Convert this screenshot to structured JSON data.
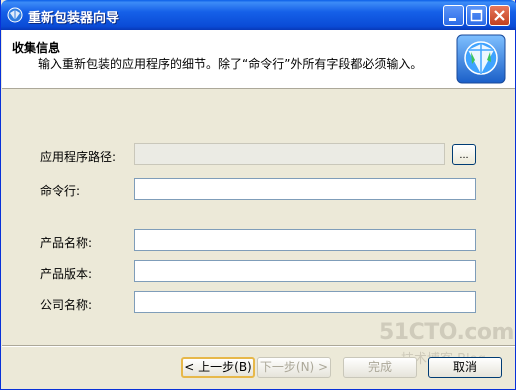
{
  "window": {
    "title": "重新包装器向导"
  },
  "header": {
    "title": "收集信息",
    "subtitle": "输入重新包装的应用程序的细节。除了“命令行”外所有字段都必须输入。"
  },
  "form": {
    "app_path_label": "应用程序路径:",
    "app_path_value": "",
    "browse_label": "...",
    "command_line_label": "命令行:",
    "command_line_value": "",
    "product_name_label": "产品名称:",
    "product_name_value": "",
    "product_version_label": "产品版本:",
    "product_version_value": "",
    "company_name_label": "公司名称:",
    "company_name_value": ""
  },
  "buttons": {
    "back": "< 上一步(B)",
    "next": "下一步(N) >",
    "finish": "完成",
    "cancel": "取消"
  },
  "watermark": {
    "main": "51CTO.com",
    "sub": "技术博客 Blog"
  },
  "colors": {
    "titlebar": "#0a4bd6",
    "dialog_bg": "#ece9d8",
    "close_button": "#c2401f"
  },
  "icons": {
    "app": "repackager-globe-icon",
    "logo": "wizard-globe-logo-icon"
  }
}
